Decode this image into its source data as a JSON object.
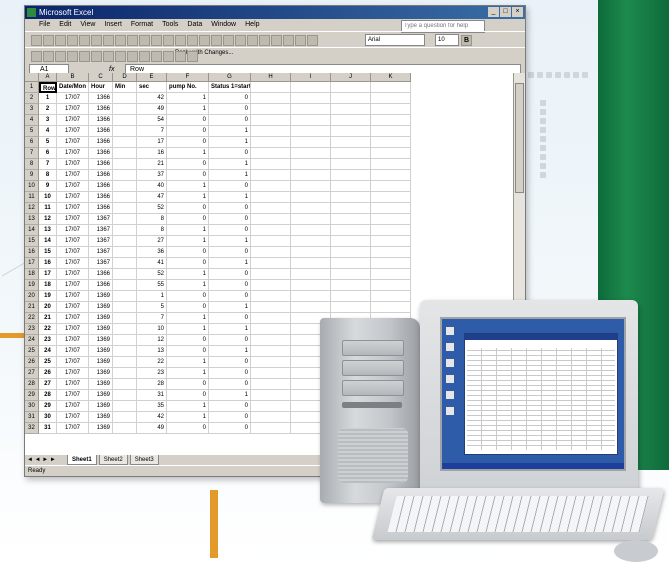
{
  "excel": {
    "title": "Microsoft Excel",
    "menus": [
      "File",
      "Edit",
      "View",
      "Insert",
      "Format",
      "Tools",
      "Data",
      "Window",
      "Help"
    ],
    "help_placeholder": "Type a question for help",
    "font_name": "Arial",
    "font_size": "10",
    "review_text": "Reply with Changes...",
    "name_box": "A1",
    "formula": "Row",
    "columns": [
      "A",
      "B",
      "C",
      "D",
      "E",
      "F",
      "G",
      "H",
      "I",
      "J",
      "K"
    ],
    "header_row": [
      "Row",
      "Date/Mon",
      "Hour",
      "Min",
      "sec",
      "pump No.",
      "Status 1=start",
      "",
      "",
      "",
      ""
    ],
    "rows": [
      [
        "1",
        "17/07",
        "1366",
        "",
        "42",
        "1",
        "0"
      ],
      [
        "2",
        "17/07",
        "1366",
        "",
        "49",
        "1",
        "0"
      ],
      [
        "3",
        "17/07",
        "1366",
        "",
        "54",
        "0",
        "0"
      ],
      [
        "4",
        "17/07",
        "1366",
        "",
        "7",
        "0",
        "1"
      ],
      [
        "5",
        "17/07",
        "1366",
        "",
        "17",
        "0",
        "1"
      ],
      [
        "6",
        "17/07",
        "1366",
        "",
        "16",
        "1",
        "0"
      ],
      [
        "7",
        "17/07",
        "1366",
        "",
        "21",
        "0",
        "1"
      ],
      [
        "8",
        "17/07",
        "1366",
        "",
        "37",
        "0",
        "1"
      ],
      [
        "9",
        "17/07",
        "1366",
        "",
        "40",
        "1",
        "0"
      ],
      [
        "10",
        "17/07",
        "1366",
        "",
        "47",
        "1",
        "1"
      ],
      [
        "11",
        "17/07",
        "1366",
        "",
        "52",
        "0",
        "0"
      ],
      [
        "12",
        "17/07",
        "1367",
        "",
        "8",
        "0",
        "0"
      ],
      [
        "13",
        "17/07",
        "1367",
        "",
        "8",
        "1",
        "0"
      ],
      [
        "14",
        "17/07",
        "1367",
        "",
        "27",
        "1",
        "1"
      ],
      [
        "15",
        "17/07",
        "1367",
        "",
        "36",
        "0",
        "0"
      ],
      [
        "16",
        "17/07",
        "1367",
        "",
        "41",
        "0",
        "1"
      ],
      [
        "17",
        "17/07",
        "1366",
        "",
        "52",
        "1",
        "0"
      ],
      [
        "18",
        "17/07",
        "1366",
        "",
        "55",
        "1",
        "0"
      ],
      [
        "19",
        "17/07",
        "1369",
        "",
        "1",
        "0",
        "0"
      ],
      [
        "20",
        "17/07",
        "1369",
        "",
        "5",
        "0",
        "1"
      ],
      [
        "21",
        "17/07",
        "1369",
        "",
        "7",
        "1",
        "0"
      ],
      [
        "22",
        "17/07",
        "1369",
        "",
        "10",
        "1",
        "1"
      ],
      [
        "23",
        "17/07",
        "1369",
        "",
        "12",
        "0",
        "0"
      ],
      [
        "24",
        "17/07",
        "1369",
        "",
        "13",
        "0",
        "1"
      ],
      [
        "25",
        "17/07",
        "1369",
        "",
        "22",
        "1",
        "0"
      ],
      [
        "26",
        "17/07",
        "1369",
        "",
        "23",
        "1",
        "0"
      ],
      [
        "27",
        "17/07",
        "1369",
        "",
        "28",
        "0",
        "0"
      ],
      [
        "28",
        "17/07",
        "1369",
        "",
        "31",
        "0",
        "1"
      ],
      [
        "29",
        "17/07",
        "1369",
        "",
        "35",
        "1",
        "0"
      ],
      [
        "30",
        "17/07",
        "1369",
        "",
        "42",
        "1",
        "0"
      ],
      [
        "31",
        "17/07",
        "1369",
        "",
        "49",
        "0",
        "0"
      ]
    ],
    "sheet_nav": "◄ ◄ ► ►",
    "sheets": [
      "Sheet1",
      "Sheet2",
      "Sheet3"
    ],
    "status": "Ready"
  }
}
